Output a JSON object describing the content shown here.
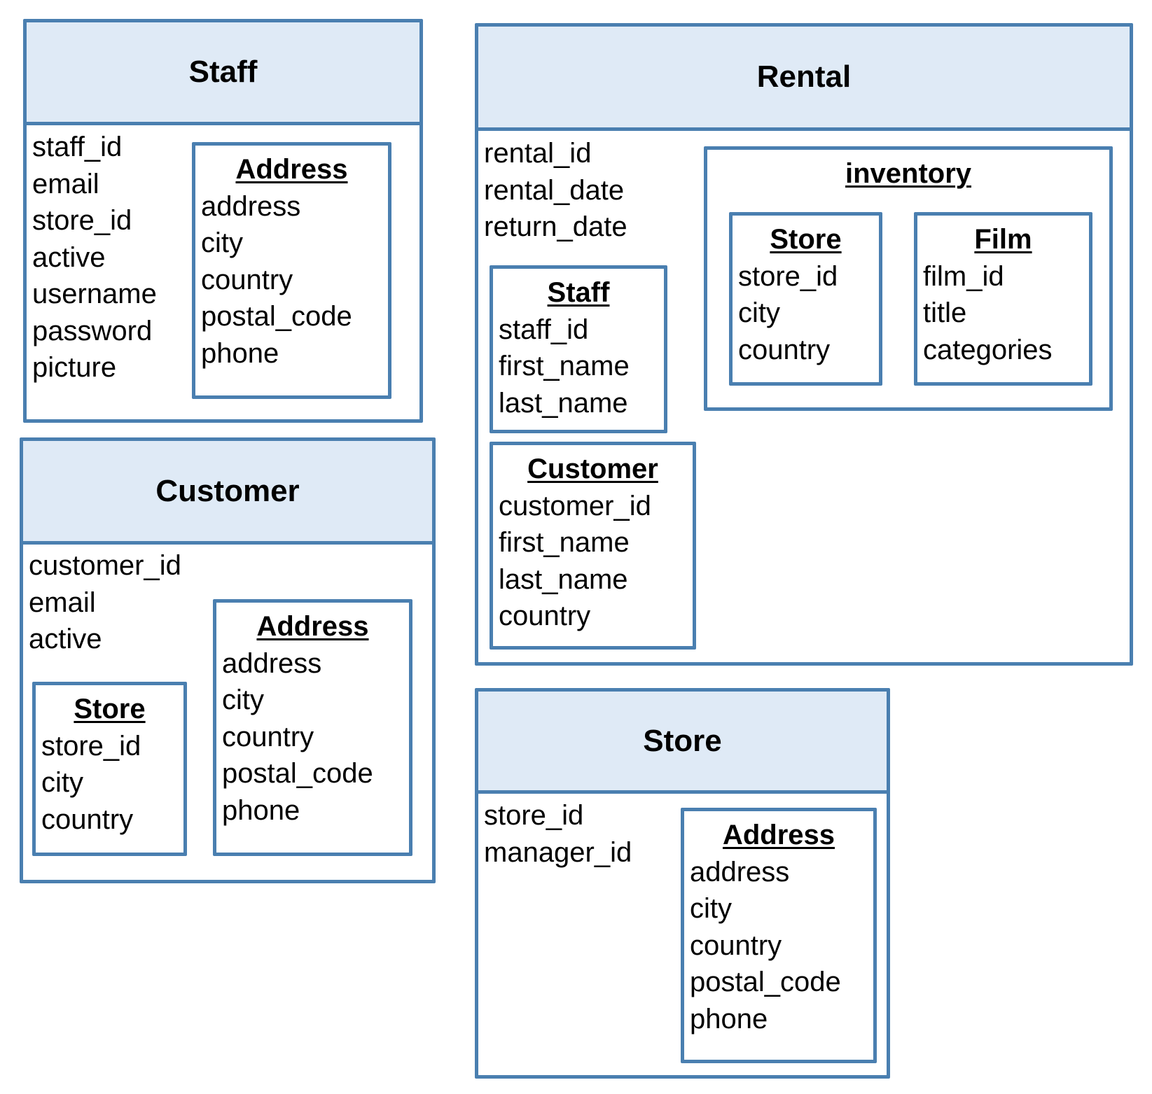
{
  "colors": {
    "border": "#4a7fb0",
    "header_fill": "#dfeaf6"
  },
  "entities": {
    "staff": {
      "title": "Staff",
      "fields": [
        "staff_id",
        "email",
        "store_id",
        "active",
        "username",
        "password",
        "picture"
      ],
      "address": {
        "title": "Address",
        "fields": [
          "address",
          "city",
          "country",
          "postal_code",
          "phone"
        ]
      }
    },
    "customer": {
      "title": "Customer",
      "fields": [
        "customer_id",
        "email",
        "active"
      ],
      "store": {
        "title": "Store",
        "fields": [
          "store_id",
          "city",
          "country"
        ]
      },
      "address": {
        "title": "Address",
        "fields": [
          "address",
          "city",
          "country",
          "postal_code",
          "phone"
        ]
      }
    },
    "rental": {
      "title": "Rental",
      "fields": [
        "rental_id",
        "rental_date",
        "return_date"
      ],
      "staff": {
        "title": "Staff",
        "fields": [
          "staff_id",
          "first_name",
          "last_name"
        ]
      },
      "customer": {
        "title": "Customer",
        "fields": [
          "customer_id",
          "first_name",
          "last_name",
          "country"
        ]
      },
      "inventory": {
        "title": "inventory",
        "store": {
          "title": "Store",
          "fields": [
            "store_id",
            "city",
            "country"
          ]
        },
        "film": {
          "title": "Film",
          "fields": [
            "film_id",
            "title",
            "categories"
          ]
        }
      }
    },
    "store": {
      "title": "Store",
      "fields": [
        "store_id",
        "manager_id"
      ],
      "address": {
        "title": "Address",
        "fields": [
          "address",
          "city",
          "country",
          "postal_code",
          "phone"
        ]
      }
    }
  }
}
